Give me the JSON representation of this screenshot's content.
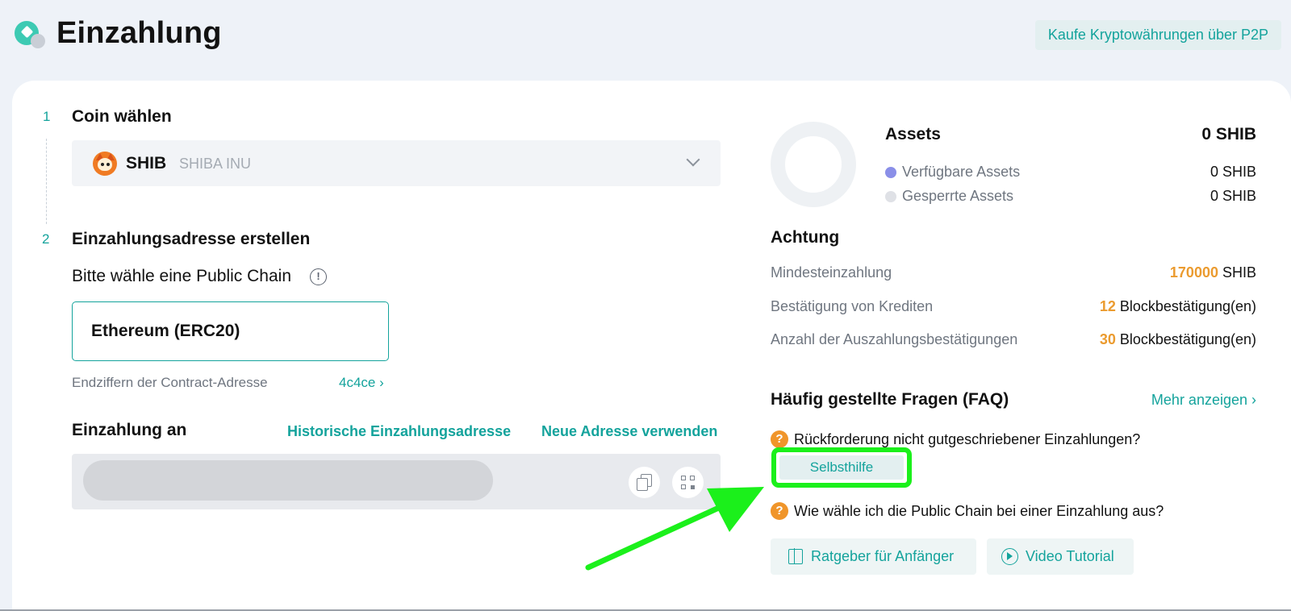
{
  "header": {
    "title": "Einzahlung",
    "p2p_button": "Kaufe Kryptowährungen über P2P"
  },
  "step1": {
    "number": "1",
    "title": "Coin wählen",
    "coin_symbol": "SHIB",
    "coin_name": "SHIBA INU",
    "coin_icon": "shiba-inu-icon"
  },
  "step2": {
    "number": "2",
    "title": "Einzahlungsadresse erstellen",
    "chain_label": "Bitte wähle eine Public Chain",
    "info_glyph": "!",
    "selected_chain": "Ethereum (ERC20)",
    "contract_label": "Endziffern der Contract-Adresse",
    "contract_value": "4c4ce"
  },
  "deposit": {
    "title": "Einzahlung an",
    "history_link": "Historische Einzahlungsadresse",
    "new_address_link": "Neue Adresse verwenden"
  },
  "assets": {
    "title": "Assets",
    "total": "0 SHIB",
    "available_label": "Verfügbare Assets",
    "available_value": "0 SHIB",
    "locked_label": "Gesperrte Assets",
    "locked_value": "0 SHIB",
    "available_color": "#8a8fe8",
    "locked_color": "#dfe1e6"
  },
  "notice": {
    "title": "Achtung",
    "min_deposit_label": "Mindesteinzahlung",
    "min_deposit_amount": "170000",
    "min_deposit_unit": " SHIB",
    "credit_label": "Bestätigung von Krediten",
    "credit_amount": "12",
    "credit_unit": " Blockbestätigung(en)",
    "withdraw_label": "Anzahl der Auszahlungsbestätigungen",
    "withdraw_amount": "30",
    "withdraw_unit": " Blockbestätigung(en)"
  },
  "faq": {
    "title": "Häufig gestellte Fragen (FAQ)",
    "more_link": "Mehr anzeigen",
    "q_glyph": "?",
    "q1": "Rückforderung nicht gutgeschriebener Einzahlungen?",
    "self_help_button": "Selbsthilfe",
    "q2": "Wie wähle ich die Public Chain bei einer Einzahlung aus?",
    "beginner_guide": "Ratgeber für Anfänger",
    "video_tutorial": "Video Tutorial"
  },
  "colors": {
    "accent": "#14a39c",
    "orange": "#eb9b2f",
    "highlight": "#1bf01b"
  }
}
